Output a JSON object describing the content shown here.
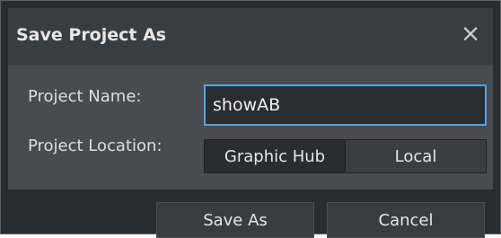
{
  "dialog": {
    "title": "Save Project As",
    "close_icon": "×"
  },
  "form": {
    "project_name_label": "Project Name:",
    "project_name_value": "showAB",
    "project_location_label": "Project Location:",
    "location_options": [
      "Graphic Hub",
      "Local"
    ],
    "selected_location": "Graphic Hub"
  },
  "actions": {
    "save_label": "Save As",
    "cancel_label": "Cancel"
  }
}
